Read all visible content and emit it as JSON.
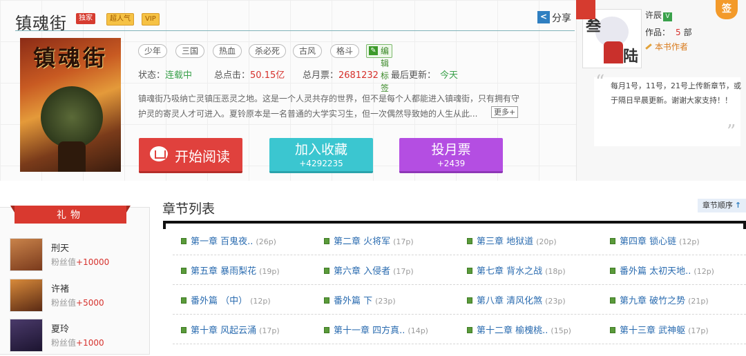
{
  "book": {
    "title": "镇魂街",
    "badges": [
      "独家",
      "超人气",
      "VIP"
    ],
    "share_label": "分享",
    "cover_title": "镇魂街",
    "tags": [
      "少年",
      "三国",
      "热血",
      "杀必死",
      "古风",
      "格斗"
    ],
    "edit_tags_label": "编辑标签",
    "status_label": "状态：",
    "status_value": "连载中",
    "clicks_label": "总点击：",
    "clicks_value": "50.15亿",
    "monthly_label": "总月票：",
    "monthly_value": "2681232",
    "updated_label": "最后更新：",
    "updated_value": "今天",
    "synopsis": "镇魂街乃吸纳亡灵镇压恶灵之地。这是一个人灵共存的世界，但不是每个人都能进入镇魂街，只有拥有守护灵的寄灵人才可进入。夏铃原本是一名普通的大学实习生，但一次偶然导致她的人生从此...",
    "more_label": "更多+"
  },
  "actions": {
    "read_label": "开始阅读",
    "favorite_label": "加入收藏",
    "favorite_count": "+4292235",
    "vote_label": "投月票",
    "vote_count": "+2439"
  },
  "author": {
    "name": "许辰",
    "verified": "V",
    "works_label": "作品：",
    "works_count": "5",
    "works_unit": "部",
    "role_label": "本书作者",
    "sign_label": "签",
    "notice": "每月1号，11号，21号上传新章节，或于隔日早晨更新。谢谢大家支持！！",
    "avatar_text": [
      "叁",
      "陆"
    ]
  },
  "gifts": {
    "title": "礼物",
    "fans": [
      {
        "name": "刑天",
        "label": "粉丝值",
        "value": "+10000"
      },
      {
        "name": "许褚",
        "label": "粉丝值",
        "value": "+5000"
      },
      {
        "name": "夏玲",
        "label": "粉丝值",
        "value": "+1000"
      }
    ]
  },
  "chapters": {
    "heading": "章节列表",
    "order_label": "章节顺序",
    "rows": [
      [
        {
          "title": "第一章  百鬼夜..",
          "pages": "(26p)"
        },
        {
          "title": "第二章  火将军",
          "pages": "(17p)"
        },
        {
          "title": "第三章  地狱道",
          "pages": "(20p)"
        },
        {
          "title": "第四章  锁心链",
          "pages": "(12p)"
        }
      ],
      [
        {
          "title": "第五章  暴雨梨花",
          "pages": "(19p)"
        },
        {
          "title": "第六章  入侵者",
          "pages": "(17p)"
        },
        {
          "title": "第七章  背水之战",
          "pages": "(18p)"
        },
        {
          "title": "番外篇  太初天地..",
          "pages": "(12p)"
        }
      ],
      [
        {
          "title": "番外篇  （中）",
          "pages": "(12p)"
        },
        {
          "title": "番外篇  下",
          "pages": "(23p)"
        },
        {
          "title": "第八章  清风化煞",
          "pages": "(23p)"
        },
        {
          "title": "第九章  破竹之势",
          "pages": "(21p)"
        }
      ],
      [
        {
          "title": "第十章  风起云涌",
          "pages": "(17p)"
        },
        {
          "title": "第十一章  四方真..",
          "pages": "(14p)"
        },
        {
          "title": "第十二章  榆槐桃..",
          "pages": "(15p)"
        },
        {
          "title": "第十三章  武神躯",
          "pages": "(17p)"
        }
      ]
    ]
  },
  "colors": {
    "accent_red": "#d6302b",
    "read_button": "#e0413d",
    "favorite_button": "#3bc6d0",
    "vote_button": "#b44ee2",
    "status_green": "#3aa14b",
    "chapter_link": "#2b6cb0"
  }
}
